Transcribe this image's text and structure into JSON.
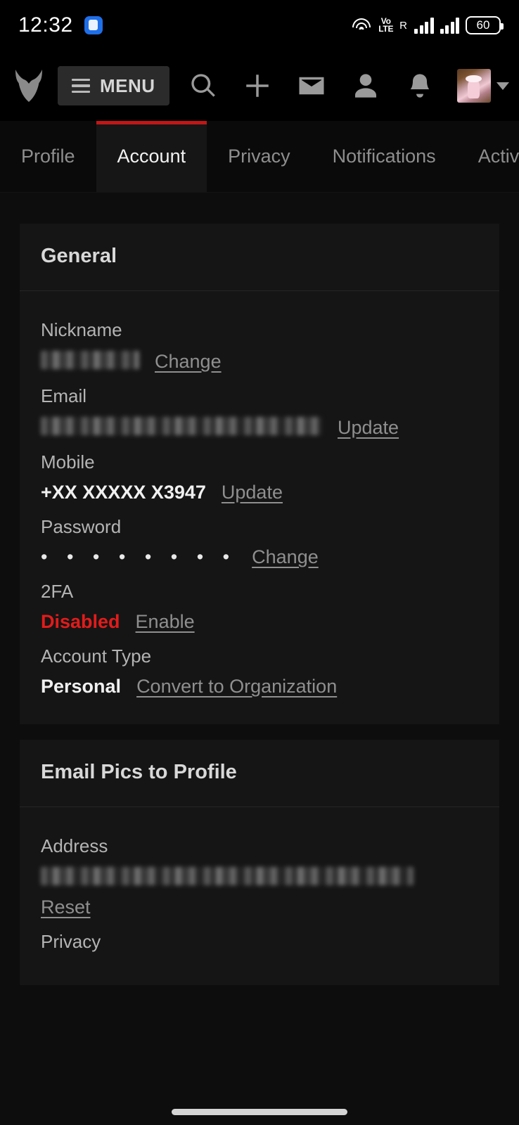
{
  "statusbar": {
    "time": "12:32",
    "app_icon": "message-app-icon",
    "wifi_icon": "wifi-icon",
    "volte_line1": "Vo",
    "volte_line2": "LTE",
    "roaming_label": "R",
    "signal_icon_1": "signal-bars-icon",
    "signal_icon_2": "signal-bars-icon",
    "battery_level": "60"
  },
  "navbar": {
    "logo_icon": "furaffinity-fox-logo-icon",
    "menu_label": "MENU",
    "menu_icon": "hamburger-icon",
    "icons": [
      {
        "name": "search-icon"
      },
      {
        "name": "plus-icon"
      },
      {
        "name": "envelope-icon"
      },
      {
        "name": "person-icon"
      },
      {
        "name": "bell-icon"
      }
    ],
    "avatar_name": "user-avatar",
    "caret_icon": "chevron-down-icon"
  },
  "tabs": [
    {
      "label": "Profile",
      "active": false
    },
    {
      "label": "Account",
      "active": true
    },
    {
      "label": "Privacy",
      "active": false
    },
    {
      "label": "Notifications",
      "active": false
    },
    {
      "label": "Activi",
      "active": false
    }
  ],
  "accent_color": "#c31616",
  "danger_color": "#e31b1b",
  "sections": [
    {
      "title": "General",
      "fields": [
        {
          "label": "Nickname",
          "value": "",
          "redacted": true,
          "action": "Change"
        },
        {
          "label": "Email",
          "value": "",
          "redacted": true,
          "action": "Update"
        },
        {
          "label": "Mobile",
          "value": "+XX XXXXX X3947",
          "redacted": false,
          "action": "Update"
        },
        {
          "label": "Password",
          "value": "• • • • • • • •",
          "redacted": false,
          "action": "Change"
        },
        {
          "label": "2FA",
          "value": "Disabled",
          "redacted": false,
          "action": "Enable"
        },
        {
          "label": "Account Type",
          "value": "Personal",
          "redacted": false,
          "action": "Convert to Organization"
        }
      ]
    },
    {
      "title": "Email Pics to Profile",
      "fields": [
        {
          "label": "Address",
          "value": "",
          "redacted": true,
          "action": "Reset"
        },
        {
          "label": "Privacy",
          "value": "",
          "redacted": false,
          "action": ""
        }
      ]
    }
  ]
}
